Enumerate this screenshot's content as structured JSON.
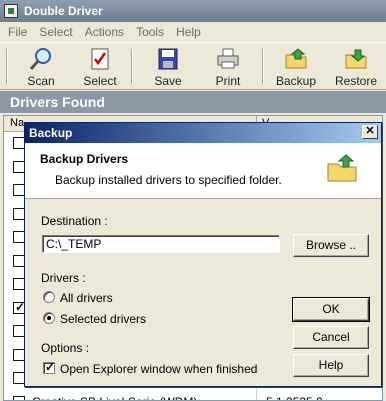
{
  "window": {
    "title": "Double Driver"
  },
  "menu": [
    "File",
    "Select",
    "Actions",
    "Tools",
    "Help"
  ],
  "toolbar": {
    "scan": "Scan",
    "select": "Select",
    "save": "Save",
    "print": "Print",
    "backup": "Backup",
    "restore": "Restore"
  },
  "section": {
    "title": "Drivers Found"
  },
  "list": {
    "col_name": "Na",
    "col_version": "V",
    "last_row_name": "Creative SB Live! Serie (WDM)",
    "last_row_version": "5.1.2535.0",
    "checked_row_index": 7
  },
  "dialog": {
    "title": "Backup",
    "heading": "Backup Drivers",
    "subheading": "Backup installed drivers to specified folder.",
    "destination_label": "Destination :",
    "destination_value": "C:\\_TEMP",
    "browse": "Browse ..",
    "drivers_label": "Drivers :",
    "radio_all": "All drivers",
    "radio_selected": "Selected drivers",
    "options_label": "Options :",
    "option_explorer": "Open Explorer window when finished",
    "ok": "OK",
    "cancel": "Cancel",
    "help": "Help"
  }
}
